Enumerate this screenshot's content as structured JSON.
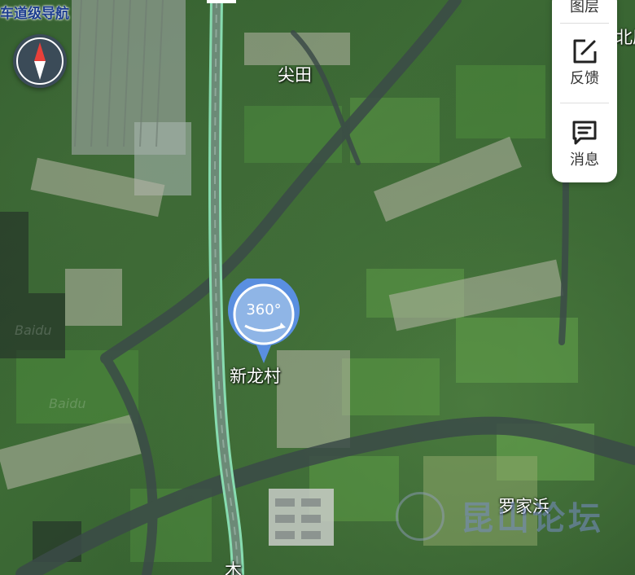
{
  "nav_mode_label": "车道级导航",
  "compass_icon": "compass-icon",
  "panel": {
    "items": [
      {
        "label": "图层",
        "icon": "layers-icon"
      },
      {
        "label": "反馈",
        "icon": "edit-feedback-icon"
      },
      {
        "label": "消息",
        "icon": "message-icon"
      }
    ]
  },
  "places": {
    "jiantian": "尖田",
    "xinlongcun": "新龙村",
    "luojiabang": "罗家浜",
    "partial_top_right": "北厍",
    "partial_bottom": "木"
  },
  "panorama_marker": {
    "label": "360°",
    "icon": "panorama-360-icon"
  },
  "watermark": {
    "text": "昆山论坛",
    "secondary": "Baidu"
  },
  "colors": {
    "road": "#7fd6a8",
    "panel_bg": "#ffffff",
    "marker": "#5a8fe0",
    "nav_label": "#1c3d8f"
  }
}
